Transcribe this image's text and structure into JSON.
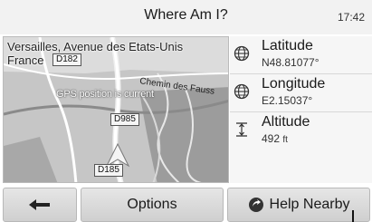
{
  "header": {
    "title": "Where Am I?",
    "time": "17:42"
  },
  "map": {
    "address_line1": "Versailles, Avenue des Etats-Unis",
    "address_line2": "France",
    "gps_status": "GPS position is current",
    "street_label": "Chemin des Fauss",
    "road_labels": [
      "D182",
      "D985",
      "D185"
    ]
  },
  "info": {
    "latitude": {
      "label": "Latitude",
      "value": "N48.81077°",
      "icon": "globe-icon"
    },
    "longitude": {
      "label": "Longitude",
      "value": "E2.15037°",
      "icon": "globe-icon"
    },
    "altitude": {
      "label": "Altitude",
      "value": "492",
      "unit": "ft",
      "icon": "altitude-icon"
    }
  },
  "bottom": {
    "back_icon": "arrow-left-icon",
    "options_label": "Options",
    "help_label": "Help Nearby",
    "help_icon": "help-nearby-icon"
  }
}
